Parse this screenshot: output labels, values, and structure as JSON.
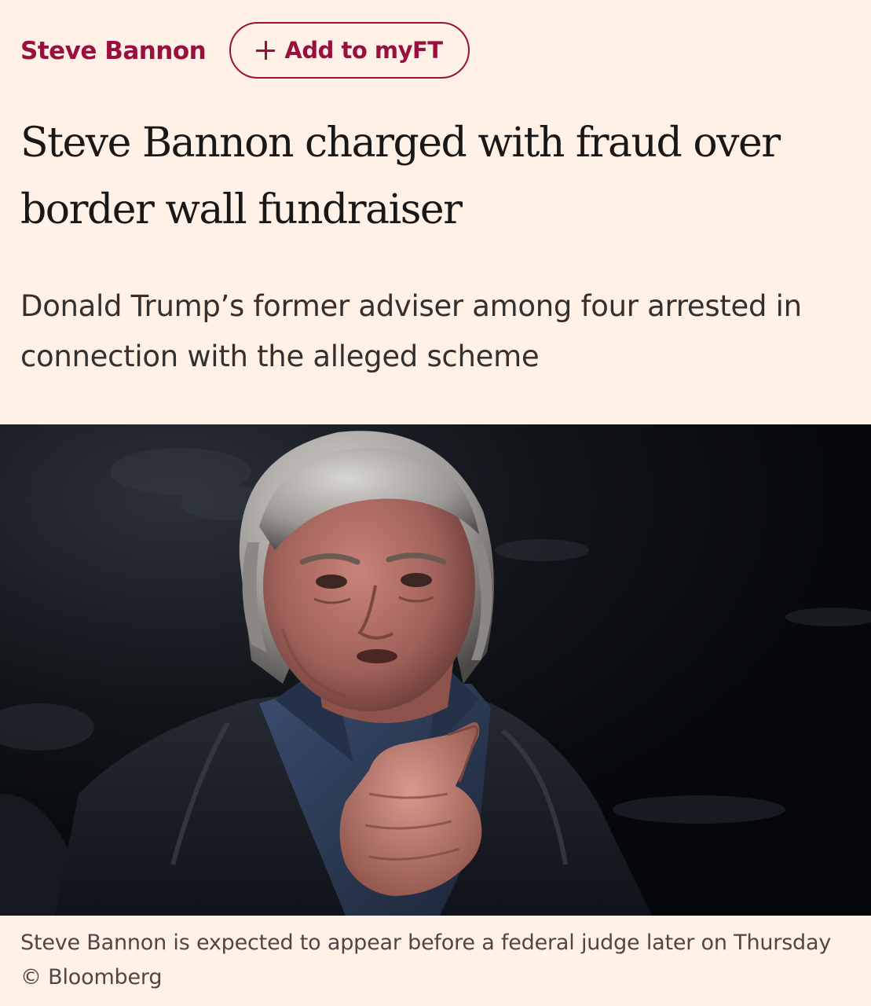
{
  "topic": {
    "label": "Steve Bannon",
    "follow_button_label": "Add to myFT"
  },
  "article": {
    "headline": "Steve Bannon charged with fraud over border wall fundraiser",
    "standfirst": "Donald Trump’s former adviser among four arrested in connection with the alleged scheme",
    "image": {
      "caption": "Steve Bannon is expected to appear before a federal judge later on Thursday © Bloomberg"
    }
  },
  "colors": {
    "page_background": "#fff1e5",
    "accent": "#990f3d",
    "headline_text": "#1a1817",
    "body_text": "#33302e",
    "caption_text": "#4d4845"
  },
  "icons": {
    "follow_button_icon": "plus-icon"
  }
}
